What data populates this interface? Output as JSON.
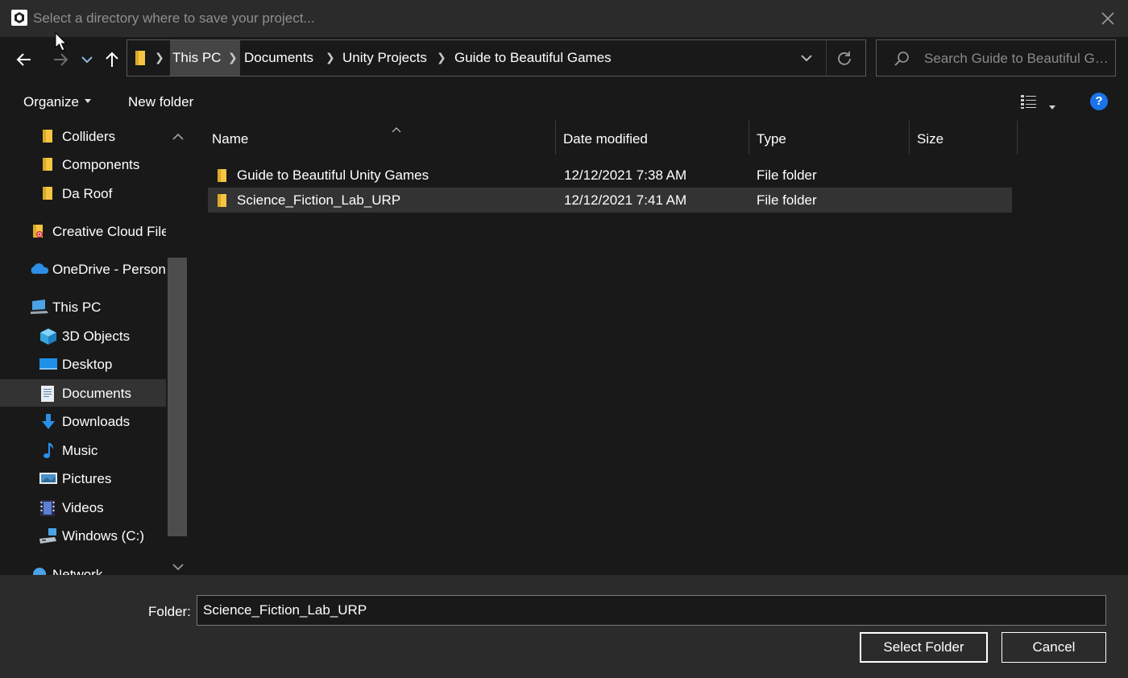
{
  "window": {
    "title": "Select a directory where to save your project...",
    "close_icon": "close-icon",
    "app_icon": "unity-logo-icon"
  },
  "nav": {
    "back_icon": "arrow-left-icon",
    "forward_icon": "arrow-right-icon",
    "recent_icon": "chevron-down-icon",
    "up_icon": "arrow-up-icon"
  },
  "address": {
    "breadcrumbs": [
      {
        "label": "This PC",
        "highlighted": true
      },
      {
        "label": "Documents",
        "highlighted": false
      },
      {
        "label": "Unity Projects",
        "highlighted": false
      },
      {
        "label": "Guide to Beautiful Games",
        "highlighted": false
      }
    ],
    "refresh_icon": "refresh-icon"
  },
  "search": {
    "placeholder": "Search Guide to Beautiful Ga..."
  },
  "toolbar": {
    "organize_label": "Organize",
    "new_folder_label": "New folder",
    "help_label": "?"
  },
  "sidebar": {
    "items": [
      {
        "label": "Colliders",
        "icon": "folder-icon"
      },
      {
        "label": "Components",
        "icon": "folder-icon"
      },
      {
        "label": "Da Roof",
        "icon": "folder-icon"
      },
      {
        "label": "Creative Cloud Files",
        "icon": "creative-cloud-folder-icon"
      },
      {
        "label": "OneDrive - Personal",
        "icon": "onedrive-cloud-icon"
      },
      {
        "label": "This PC",
        "icon": "computer-icon"
      },
      {
        "label": "3D Objects",
        "icon": "cube-icon"
      },
      {
        "label": "Desktop",
        "icon": "desktop-icon"
      },
      {
        "label": "Documents",
        "icon": "document-icon",
        "selected": true
      },
      {
        "label": "Downloads",
        "icon": "download-arrow-icon"
      },
      {
        "label": "Music",
        "icon": "music-note-icon"
      },
      {
        "label": "Pictures",
        "icon": "picture-icon"
      },
      {
        "label": "Videos",
        "icon": "film-icon"
      },
      {
        "label": "Windows (C:)",
        "icon": "drive-icon"
      },
      {
        "label": "Network",
        "icon": "network-icon"
      }
    ]
  },
  "filelist": {
    "columns": [
      "Name",
      "Date modified",
      "Type",
      "Size"
    ],
    "rows": [
      {
        "name": "Guide to Beautiful Unity Games",
        "date": "12/12/2021 7:38 AM",
        "type": "File folder",
        "size": "",
        "selected": false
      },
      {
        "name": "Science_Fiction_Lab_URP",
        "date": "12/12/2021 7:41 AM",
        "type": "File folder",
        "size": "",
        "selected": true
      }
    ]
  },
  "footer": {
    "folder_label": "Folder:",
    "folder_value": "Science_Fiction_Lab_URP",
    "select_button": "Select Folder",
    "cancel_button": "Cancel"
  },
  "colors": {
    "background": "#191919",
    "chrome": "#2b2b2b",
    "selection": "#333333",
    "accent": "#1a73e8",
    "folder_yellow": "#f5c542"
  }
}
